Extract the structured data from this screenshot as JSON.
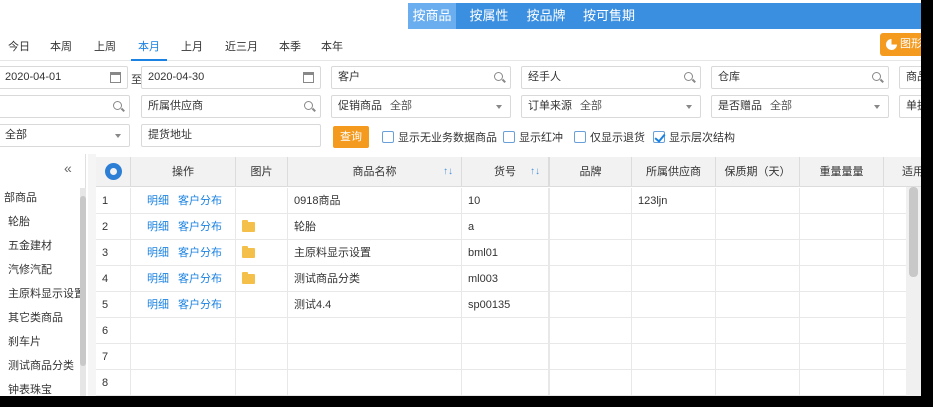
{
  "top_tabs": [
    "按商品",
    "按属性",
    "按品牌",
    "按可售期"
  ],
  "top_tab_active": 0,
  "date_tabs": [
    "今日",
    "本周",
    "上周",
    "本月",
    "上月",
    "近三月",
    "本季",
    "本年"
  ],
  "date_tab_active": 3,
  "chart_button_label": "图形",
  "filters": {
    "date_from": "2020-04-01",
    "date_to": "2020-04-30",
    "date_sep": "至",
    "customer": "客户",
    "handler": "经手人",
    "warehouse": "仓库",
    "product_label": "商品",
    "supplier": "所属供应商",
    "promo_label": "促销商品",
    "promo_value": "全部",
    "order_source_label": "订单来源",
    "order_source_value": "全部",
    "gift_label": "是否赠品",
    "gift_value": "全部",
    "unit_label": "单据",
    "row3_select_value": "全部",
    "pickup_address": "提货地址",
    "query_label": "查询"
  },
  "checkboxes": [
    {
      "label": "显示无业务数据商品",
      "checked": false
    },
    {
      "label": "显示红冲",
      "checked": false
    },
    {
      "label": "仅显示退货",
      "checked": false
    },
    {
      "label": "显示层次结构",
      "checked": true
    }
  ],
  "sidebar": {
    "collapse_icon": "double-chevron-left-icon",
    "items": [
      "部商品",
      "轮胎",
      "五金建材",
      "汽修汽配",
      "主原料显示设置",
      "其它类商品",
      "刹车片",
      "测试商品分类",
      "钟表珠宝"
    ]
  },
  "table": {
    "headers": [
      "操作",
      "图片",
      "商品名称",
      "货号",
      "品牌",
      "所属供应商",
      "保质期（天）",
      "重量量量",
      "适用"
    ],
    "action_links": [
      "明细",
      "客户分布"
    ],
    "rows": [
      {
        "no": "1",
        "folder": false,
        "name": "0918商品",
        "code": "10",
        "brand": "",
        "supplier": "123ljn"
      },
      {
        "no": "2",
        "folder": true,
        "name": "轮胎",
        "code": "a",
        "brand": "",
        "supplier": ""
      },
      {
        "no": "3",
        "folder": true,
        "name": "主原料显示设置",
        "code": "bml01",
        "brand": "",
        "supplier": ""
      },
      {
        "no": "4",
        "folder": true,
        "name": "测试商品分类",
        "code": "ml003",
        "brand": "",
        "supplier": ""
      },
      {
        "no": "5",
        "folder": false,
        "name": "测试4.4",
        "code": "sp00135",
        "brand": "",
        "supplier": ""
      },
      {
        "no": "6",
        "empty": true
      },
      {
        "no": "7",
        "empty": true
      },
      {
        "no": "8",
        "empty": true
      }
    ]
  }
}
